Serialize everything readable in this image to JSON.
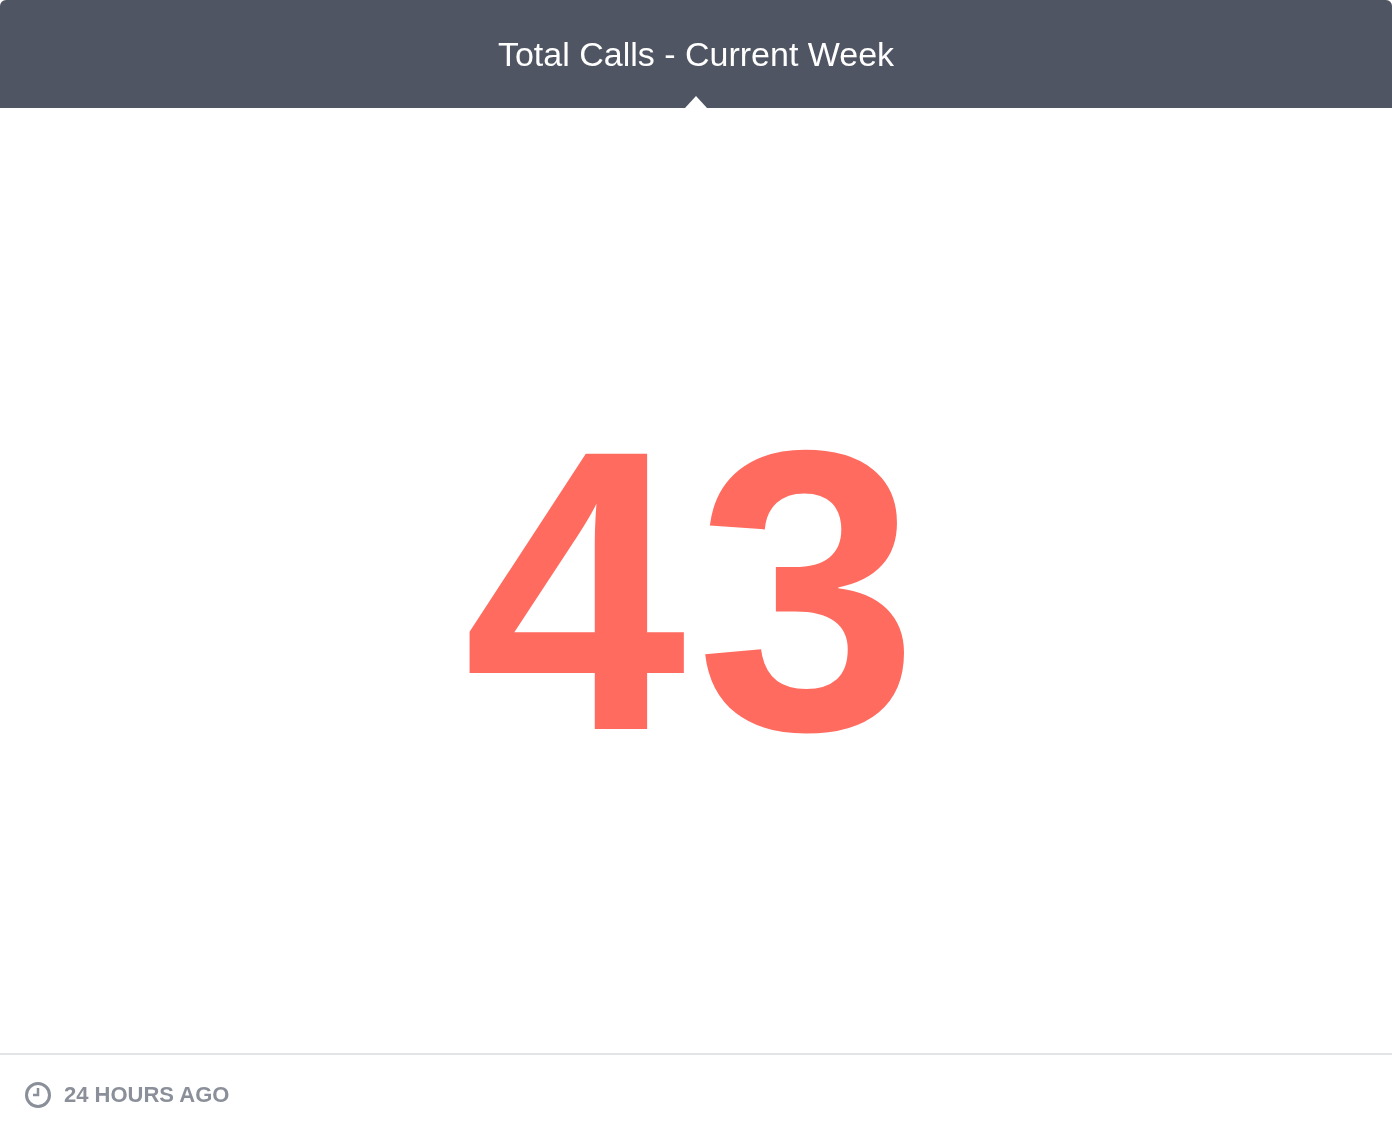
{
  "header": {
    "title": "Total Calls - Current Week"
  },
  "metric": {
    "value": "43"
  },
  "footer": {
    "updated": "24 HOURS AGO"
  }
}
